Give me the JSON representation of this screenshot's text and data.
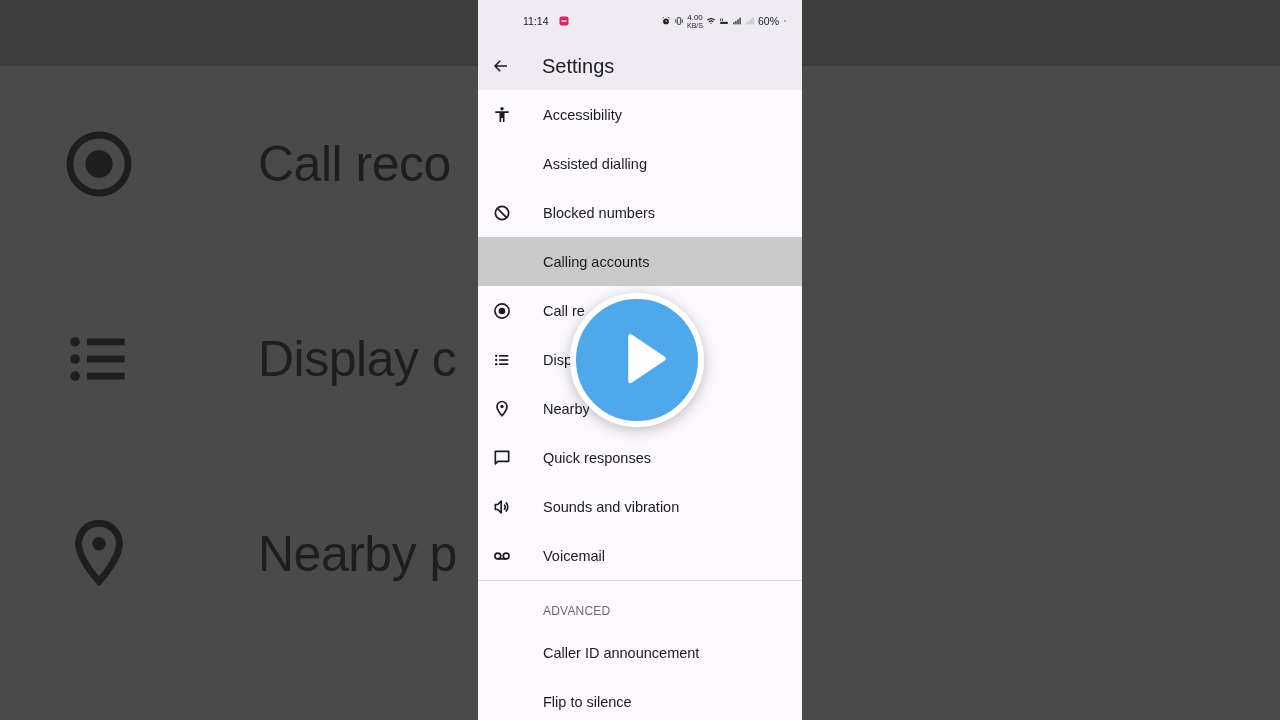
{
  "background": {
    "rows": [
      {
        "kind": "record",
        "label": "Call reco"
      },
      {
        "kind": "list",
        "label": "Display c"
      },
      {
        "kind": "pin",
        "label": "Nearby p"
      }
    ]
  },
  "status_bar": {
    "time": "11:14",
    "net_speed": "4.00",
    "net_unit": "KB/S",
    "battery": "60%"
  },
  "app_bar": {
    "title": "Settings"
  },
  "items": [
    {
      "kind": "accessibility",
      "label": "Accessibility",
      "pressed": false
    },
    {
      "kind": "plain",
      "label": "Assisted dialling",
      "pressed": false
    },
    {
      "kind": "block",
      "label": "Blocked numbers",
      "pressed": false
    },
    {
      "kind": "plain",
      "label": "Calling accounts",
      "pressed": true
    },
    {
      "kind": "record",
      "label": "Call re",
      "pressed": false
    },
    {
      "kind": "list",
      "label": "Disp",
      "pressed": false
    },
    {
      "kind": "pin",
      "label": "Nearby",
      "pressed": false
    },
    {
      "kind": "chat",
      "label": "Quick responses",
      "pressed": false
    },
    {
      "kind": "volume",
      "label": "Sounds and vibration",
      "pressed": false
    },
    {
      "kind": "voicemail",
      "label": "Voicemail",
      "pressed": false
    }
  ],
  "advanced": {
    "header": "ADVANCED",
    "items": [
      {
        "label": "Caller ID announcement",
        "pressed": false
      },
      {
        "label": "Flip to silence",
        "pressed": false
      }
    ]
  }
}
